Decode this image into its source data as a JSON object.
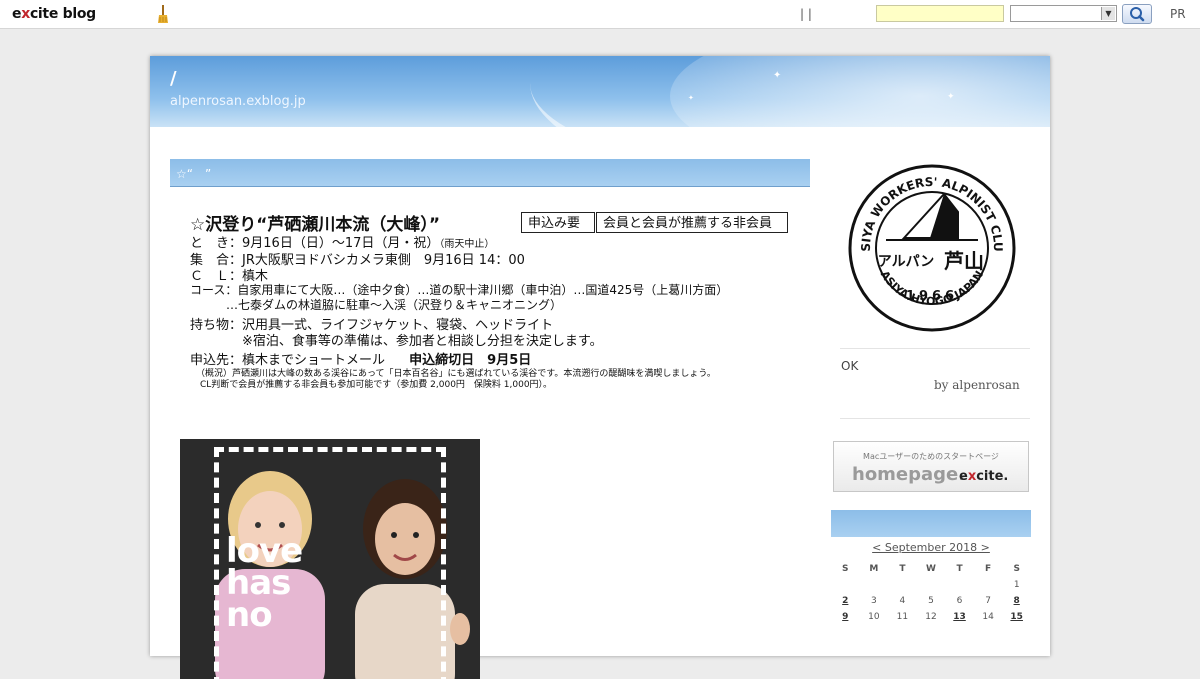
{
  "topbar": {
    "logo_prefix": "e",
    "logo_x": "x",
    "logo_rest": "cite blog",
    "separators": "|    |",
    "search_input_value": "",
    "search_select_value": "",
    "pr_label": "PR"
  },
  "header": {
    "title": "/",
    "url": "alpenrosan.exblog.jp"
  },
  "post": {
    "title": "☆“　”",
    "flyer": {
      "title": "☆沢登り“芦硒瀬川本流（大峰）”",
      "tag_apply": "申込み要",
      "tag_members": "会員と会員が推薦する非会員",
      "line_date": "と　き：9月16日（日）～17日（月・祝）",
      "line_date_note": "（雨天中止）",
      "line_meet": "集　合：JR大阪駅ヨドバシカメラ東側　9月16日 14：00",
      "line_cl": "Ｃ　Ｌ：槙木",
      "line_course": "コース：自家用車にて大阪…（途中夕食）…道の駅十津川郷（車中泊）…国道425号（上葛川方面）",
      "line_course2": "　　　…七泰ダムの林道脇に駐車～入渓（沢登り＆キャニオニング）",
      "line_gear": "持ち物：沢用具一式、ライフジャケット、寝袋、ヘッドライト",
      "line_gear2": "　　　　※宿泊、食事等の準備は、参加者と相談し分担を決定します。",
      "line_apply": "申込先：槙木までショートメール",
      "line_deadline": "申込締切日　9月5日",
      "note1": "（概況）芦硒瀬川は大峰の数ある渓谷にあって「日本百名谷」にも選ばれている渓谷です。本流遡行の醍醐味を満喫しましょう。",
      "note2": "CL判断で会員が推薦する非会員も参加可能です（参加費 2,000円　保険料 1,000円）。"
    },
    "photo_text": [
      "love",
      "has",
      "no"
    ]
  },
  "sidebar": {
    "emblem": {
      "ring_text": "ASIYA WORKERS' ALPINIST CLUB",
      "year": "1966",
      "bottom_text": "ASIYA.HYOGO.JAPAN",
      "center_text": "アルパン",
      "kanji": "芦山"
    },
    "ok_text": "OK",
    "byline": "by alpenrosan",
    "banner": {
      "caption": "Macユーザーのためのスタートページ",
      "brand": "homepage.",
      "logo_prefix": "e",
      "logo_x": "x",
      "logo_rest": "cite."
    },
    "calendar": {
      "month": "< September 2018 >",
      "weekdays": [
        "S",
        "M",
        "T",
        "W",
        "T",
        "F",
        "S"
      ],
      "weeks": [
        [
          "",
          "",
          "",
          "",
          "",
          "",
          "1"
        ],
        [
          "2",
          "3",
          "4",
          "5",
          "6",
          "7",
          "8"
        ],
        [
          "9",
          "10",
          "11",
          "12",
          "13",
          "14",
          "15"
        ]
      ],
      "linked_days": [
        "2",
        "8",
        "9",
        "13",
        "15"
      ]
    }
  },
  "colors": {
    "header_blue": "#5d9ddb",
    "bar_blue": "#8cbde8",
    "search_yellow": "#ffffc6",
    "excite_red": "#c1272d"
  }
}
